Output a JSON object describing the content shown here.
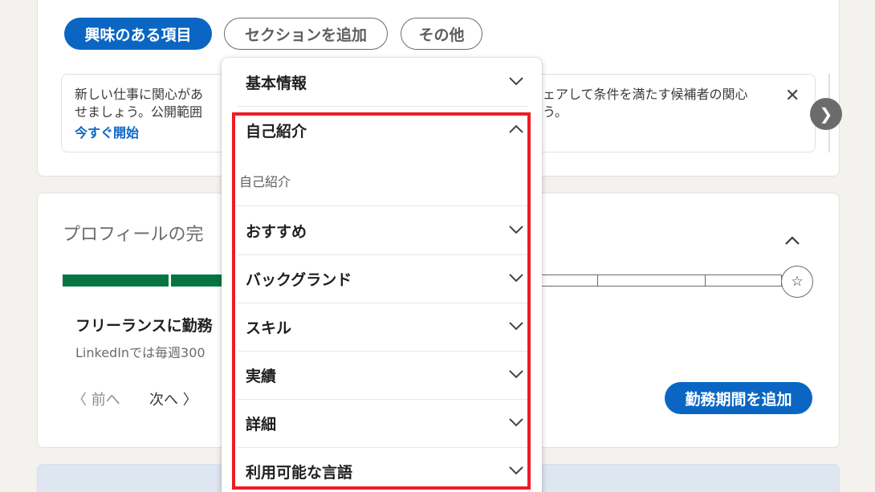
{
  "tabs": {
    "interests": "興味のある項目",
    "add_section": "セクションを追加",
    "more": "その他"
  },
  "info_banner": {
    "line1_left": "新しい仕事に関心があ",
    "line1_right": "ェアして条件を満たす候補者の関心",
    "line2_left": "せましょう。公開範囲",
    "line2_right": "う。",
    "link": "今すぐ開始",
    "close": "✕",
    "next": "❯"
  },
  "profile": {
    "title": "プロフィールの完",
    "freelance_title": "フリーランスに勤務",
    "freelance_sub": "LinkedInでは毎週300",
    "pager_prev": "〈 前へ",
    "pager_next": "次へ 〉",
    "add_tenure": "勤務期間を追加",
    "star": "☆"
  },
  "dropdown": {
    "items": [
      {
        "label": "基本情報",
        "expanded": false
      },
      {
        "label": "自己紹介",
        "expanded": true,
        "sub_items": [
          "自己紹介"
        ]
      },
      {
        "label": "おすすめ",
        "expanded": false
      },
      {
        "label": "バックグランド",
        "expanded": false
      },
      {
        "label": "スキル",
        "expanded": false
      },
      {
        "label": "実績",
        "expanded": false
      },
      {
        "label": "詳細",
        "expanded": false
      },
      {
        "label": "利用可能な言語",
        "expanded": false
      }
    ]
  },
  "colors": {
    "primary": "#0a66c2",
    "progress": "#057642",
    "highlight": "#ee1c25",
    "background": "#f4f2ee"
  }
}
